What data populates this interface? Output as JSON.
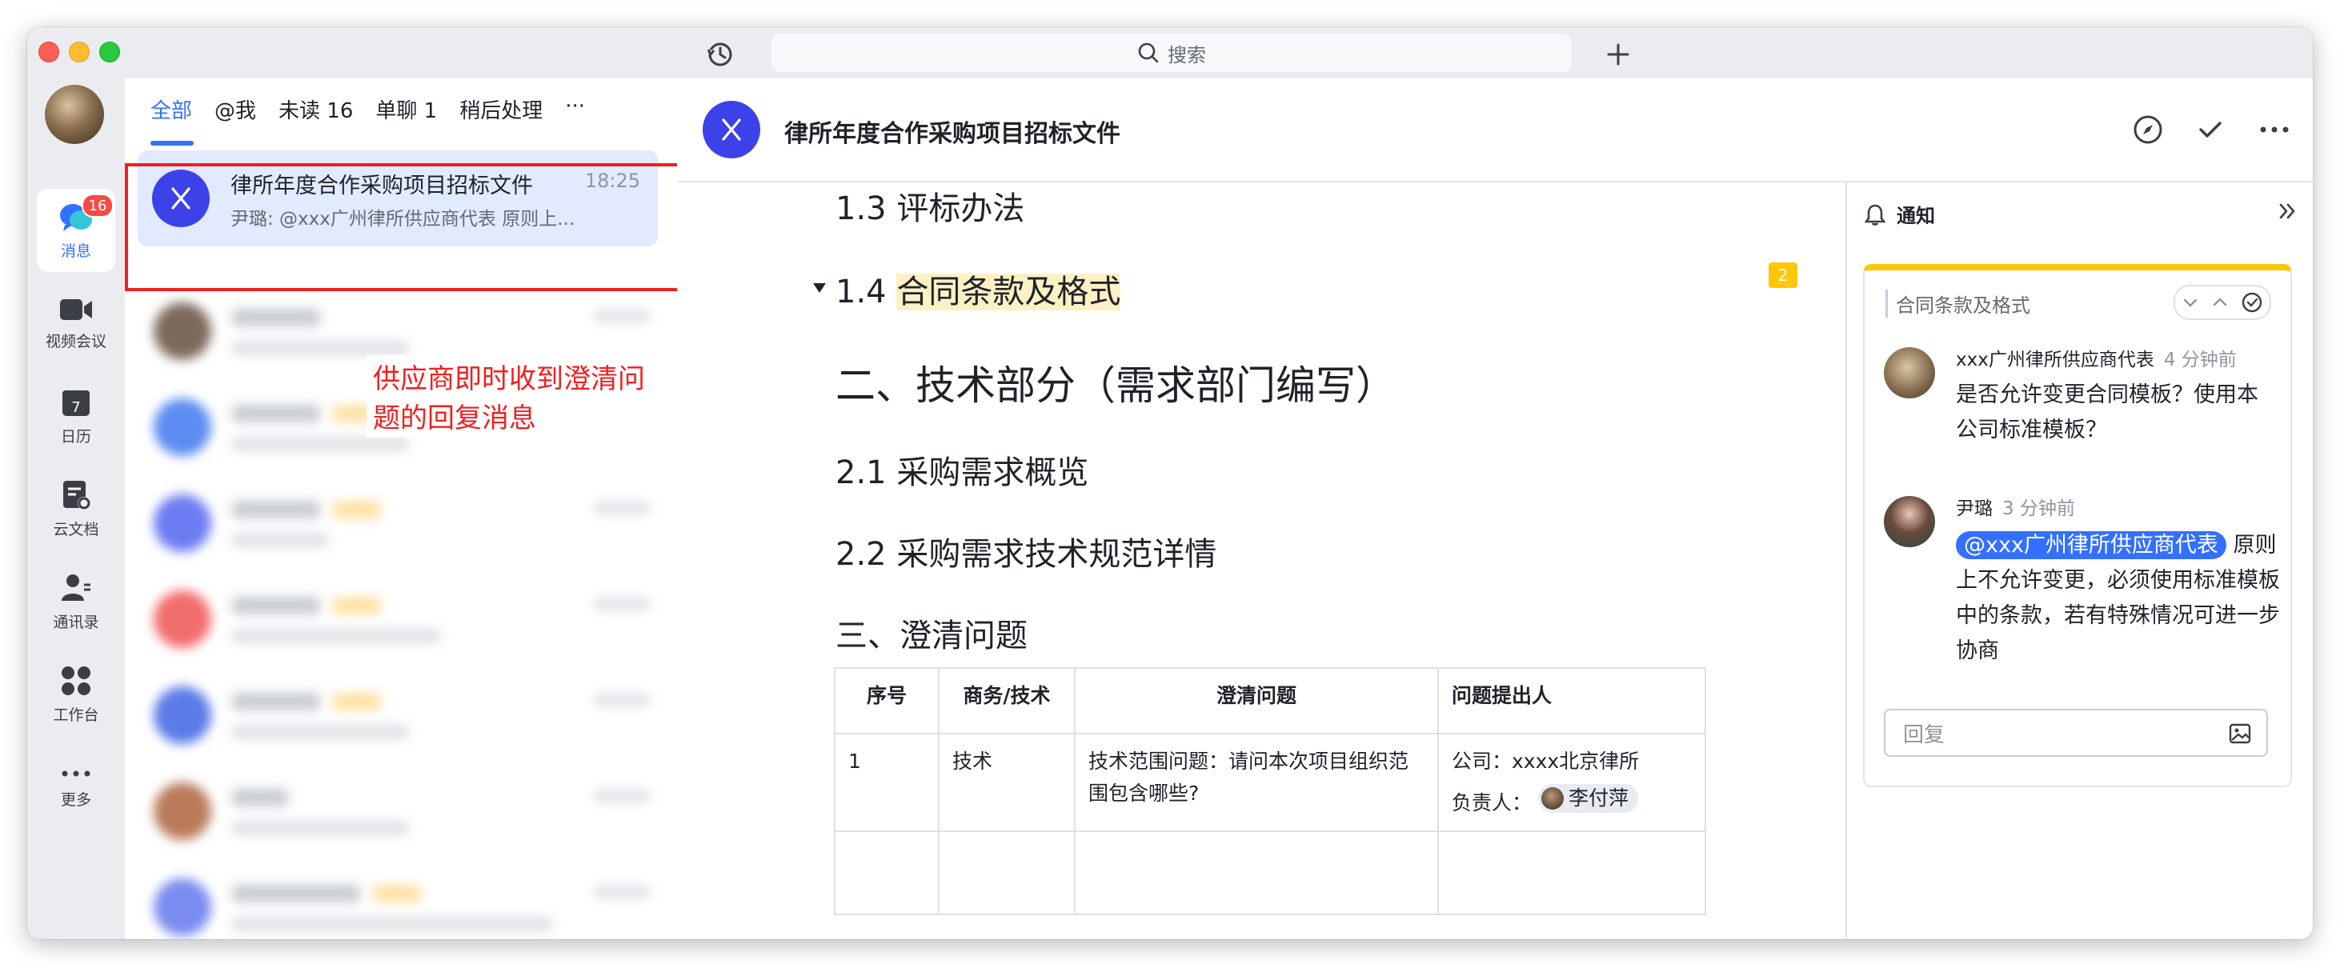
{
  "titlebar": {
    "search_placeholder": "搜索"
  },
  "rail": {
    "items": [
      {
        "label": "消息",
        "badge": "16"
      },
      {
        "label": "视频会议"
      },
      {
        "label": "日历",
        "calendar_day": "7"
      },
      {
        "label": "云文档"
      },
      {
        "label": "通讯录"
      },
      {
        "label": "工作台"
      },
      {
        "label": "更多"
      }
    ]
  },
  "chatlist": {
    "tabs": [
      "全部",
      "@我",
      "未读 16",
      "单聊 1",
      "稍后处理",
      "···"
    ],
    "active_chat": {
      "title": "律所年度合作采购项目招标文件",
      "time": "18:25",
      "preview": "尹璐: @xxx广州律所供应商代表 原则上..."
    },
    "annotation": "供应商即时收到澄清问题的回复消息"
  },
  "main": {
    "title": "律所年度合作采购项目招标文件",
    "doc": {
      "h_1_3": "1.3 评标办法",
      "h_1_4_num": "1.4 ",
      "h_1_4_text": "合同条款及格式",
      "comment_count": "2",
      "h_tech": "二、技术部分（需求部门编写）",
      "h_2_1": "2.1 采购需求概览",
      "h_2_2": "2.2 采购需求技术规范详情",
      "h_clarify": "三、澄清问题",
      "table": {
        "headers": [
          "序号",
          "商务/技术",
          "澄清问题",
          "问题提出人"
        ],
        "rows": [
          {
            "no": "1",
            "type": "技术",
            "question": "技术范围问题：请问本次项目组织范围包含哪些?",
            "company": "公司：xxxx北京律所",
            "owner_label": "负责人：",
            "owner": "李付萍"
          }
        ]
      }
    },
    "notification": {
      "title": "通知",
      "card_title": "合同条款及格式",
      "messages": [
        {
          "name": "xxx广州律所供应商代表",
          "time": "4 分钟前",
          "body": "是否允许变更合同模板？使用本公司标准模板？"
        },
        {
          "name": "尹璐",
          "time": "3 分钟前",
          "mention": "@xxx广州律所供应商代表",
          "body": " 原则上不允许变更，必须使用标准模板中的条款，若有特殊情况可进一步协商"
        }
      ],
      "reply_placeholder": "回复"
    }
  },
  "colors": {
    "accent": "#3370ff",
    "group_avatar": "#3d41e8",
    "annotation_red": "#f21f1f",
    "highlight": "#fdf0c4",
    "comment_yellow": "#ffc60a"
  }
}
